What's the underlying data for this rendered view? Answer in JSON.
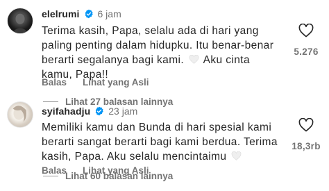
{
  "comments": [
    {
      "username": "elelrumi",
      "time": "6 jam",
      "text_before_heart": "Terima kasih, Papa, selalu ada di hari yang paling penting dalam hidupku. Itu benar-benar berarti segalanya bagi kami.",
      "text_after_heart": "Aku cinta kamu, Papa!!",
      "reply_label": "Balas",
      "see_original_label": "Lihat yang Asli",
      "more_replies_label": "Lihat 27 balasan lainnya",
      "like_count": "5.276"
    },
    {
      "username": "syifahadju",
      "time": "23 jam",
      "text_before_heart": "Memiliki kamu dan Bunda di hari spesial kami berarti sangat berarti bagi kami berdua. Terima kasih, Papa. Aku selalu mencintaimu",
      "text_after_heart": "",
      "reply_label": "Balas",
      "see_original_label": "Lihat yang Asli",
      "more_replies_label": "Lihat 60 balasan lainnya",
      "like_count": "18,3rb"
    }
  ],
  "icons": {
    "verified": "verified-badge-icon",
    "like": "heart-outline-icon",
    "inline_heart": "white-heart-emoji-icon"
  },
  "colors": {
    "text": "#262626",
    "secondary": "#737373",
    "verified": "#0095f6"
  }
}
